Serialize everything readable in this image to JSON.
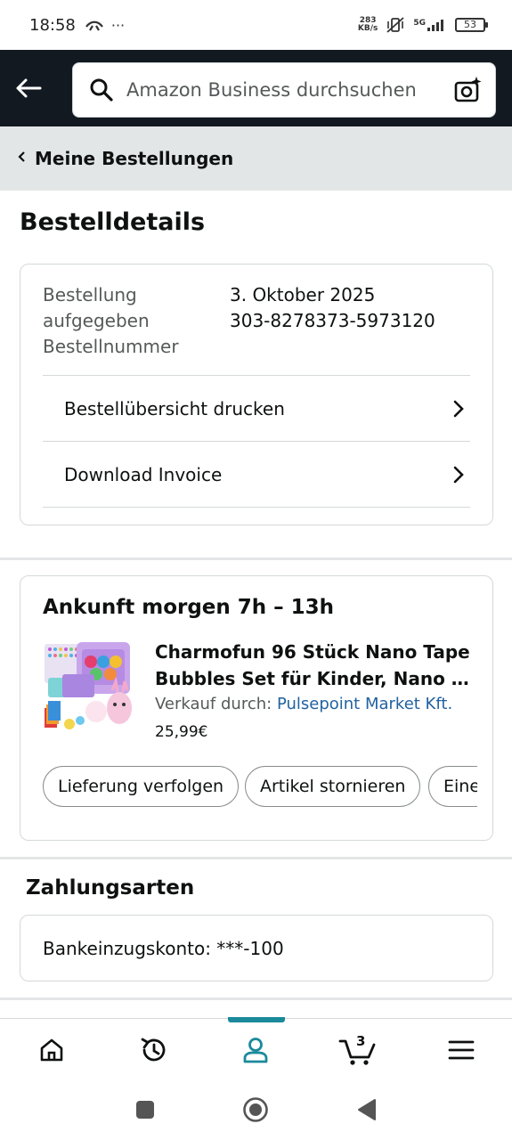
{
  "status_bar": {
    "time": "18:58",
    "extra": "···",
    "net_speed_value": "283",
    "net_speed_unit": "KB/s",
    "network": "5G",
    "battery": "53"
  },
  "header": {
    "search_placeholder": "Amazon Business durchsuchen"
  },
  "breadcrumb": {
    "label": "Meine Bestellungen"
  },
  "page": {
    "title": "Bestelldetails"
  },
  "order": {
    "placed_label_line1": "Bestellung",
    "placed_label_line2": "aufgegeben",
    "number_label": "Bestellnummer",
    "placed_date": "3. Oktober 2025",
    "number": "303-8278373-5973120",
    "actions": [
      {
        "label": "Bestellübersicht drucken"
      },
      {
        "label": "Download Invoice"
      }
    ]
  },
  "shipment": {
    "title": "Ankunft morgen 7h – 13h",
    "product": {
      "title_line1": "Charmofun 96 Stück Nano Tape",
      "title_line2": "Bubbles Set für Kinder, Nano T...",
      "seller_prefix": "Verkauf durch: ",
      "seller_name": "Pulsepoint Market Kft.",
      "price": "25,99€"
    },
    "buttons": [
      {
        "label": "Lieferung verfolgen"
      },
      {
        "label": "Artikel stornieren"
      },
      {
        "label": "Eine"
      }
    ]
  },
  "payment": {
    "title": "Zahlungsarten",
    "method": "Bankeinzugskonto: ***-100"
  },
  "bottom_nav": {
    "items": [
      {
        "icon": "home-icon"
      },
      {
        "icon": "orders-refresh-icon"
      },
      {
        "icon": "account-icon"
      },
      {
        "icon": "cart-icon"
      },
      {
        "icon": "menu-icon"
      }
    ],
    "cart_count": "3",
    "active_color": "#1b8a9b"
  },
  "colors": {
    "header_bg": "#131921",
    "breadcrumb_bg": "#e3e6e6",
    "link": "#2162a1"
  }
}
